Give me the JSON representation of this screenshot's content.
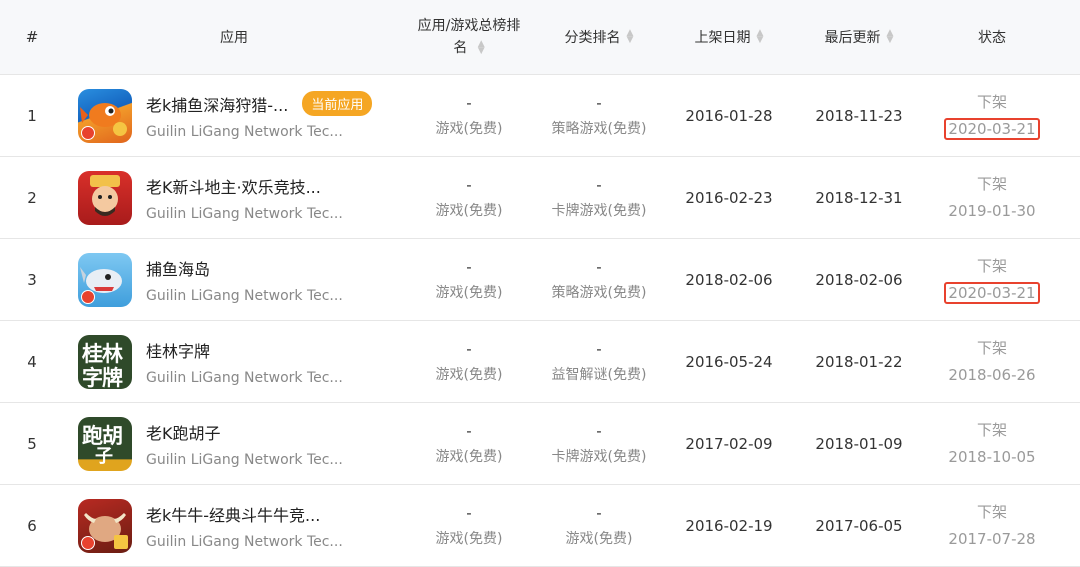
{
  "headers": {
    "index": "#",
    "app": "应用",
    "total_rank": "应用/游戏总榜排名",
    "category_rank": "分类排名",
    "release_date": "上架日期",
    "last_update": "最后更新",
    "status": "状态"
  },
  "sort_icon": "sort-updown-icon",
  "current_badge": "当前应用",
  "rows": [
    {
      "index": "1",
      "name": "老k捕鱼深海狩猎-...",
      "developer": "Guilin LiGang Network Tec...",
      "total_rank": "-",
      "total_sub": "游戏(免费)",
      "cat_rank": "-",
      "cat_sub": "策略游戏(免费)",
      "release": "2016-01-28",
      "update": "2018-11-23",
      "status": "下架",
      "status_date": "2020-03-21",
      "highlighted": true,
      "current": true,
      "icon": "fish-game-icon"
    },
    {
      "index": "2",
      "name": "老K新斗地主·欢乐竞技...",
      "developer": "Guilin LiGang Network Tec...",
      "total_rank": "-",
      "total_sub": "游戏(免费)",
      "cat_rank": "-",
      "cat_sub": "卡牌游戏(免费)",
      "release": "2016-02-23",
      "update": "2018-12-31",
      "status": "下架",
      "status_date": "2019-01-30",
      "highlighted": false,
      "current": false,
      "icon": "landlord-game-icon"
    },
    {
      "index": "3",
      "name": "捕鱼海岛",
      "developer": "Guilin LiGang Network Tec...",
      "total_rank": "-",
      "total_sub": "游戏(免费)",
      "cat_rank": "-",
      "cat_sub": "策略游戏(免费)",
      "release": "2018-02-06",
      "update": "2018-02-06",
      "status": "下架",
      "status_date": "2020-03-21",
      "highlighted": true,
      "current": false,
      "icon": "shark-game-icon"
    },
    {
      "index": "4",
      "name": "桂林字牌",
      "developer": "Guilin LiGang Network Tec...",
      "total_rank": "-",
      "total_sub": "游戏(免费)",
      "cat_rank": "-",
      "cat_sub": "益智解谜(免费)",
      "release": "2016-05-24",
      "update": "2018-01-22",
      "status": "下架",
      "status_date": "2018-06-26",
      "highlighted": false,
      "current": false,
      "icon": "guilin-zipai-icon"
    },
    {
      "index": "5",
      "name": "老K跑胡子",
      "developer": "Guilin LiGang Network Tec...",
      "total_rank": "-",
      "total_sub": "游戏(免费)",
      "cat_rank": "-",
      "cat_sub": "卡牌游戏(免费)",
      "release": "2017-02-09",
      "update": "2018-01-09",
      "status": "下架",
      "status_date": "2018-10-05",
      "highlighted": false,
      "current": false,
      "icon": "paohuzi-icon"
    },
    {
      "index": "6",
      "name": "老k牛牛-经典斗牛牛竞...",
      "developer": "Guilin LiGang Network Tec...",
      "total_rank": "-",
      "total_sub": "游戏(免费)",
      "cat_rank": "-",
      "cat_sub": "游戏(免费)",
      "release": "2016-02-19",
      "update": "2017-06-05",
      "status": "下架",
      "status_date": "2017-07-28",
      "highlighted": false,
      "current": false,
      "icon": "niuniu-game-icon"
    }
  ],
  "icon_text": {
    "zipai": [
      "桂林",
      "字牌"
    ],
    "paohuzi": [
      "跑胡",
      "子"
    ]
  },
  "colors": {
    "badge": "#f5a623",
    "highlight_border": "#e8422e",
    "header_bg": "#f7f8fa"
  }
}
